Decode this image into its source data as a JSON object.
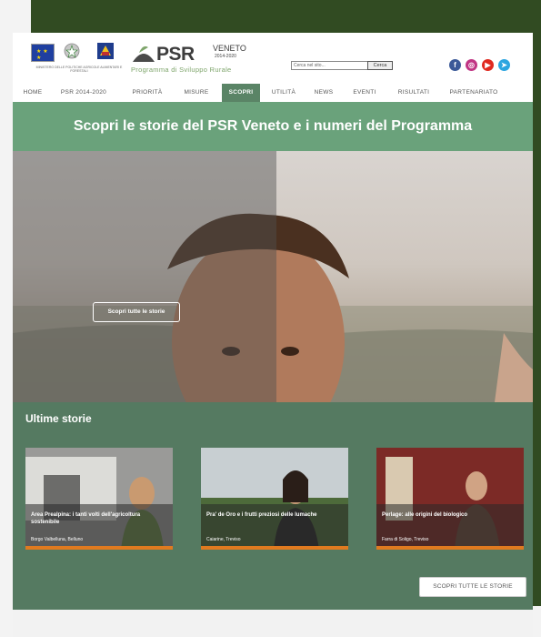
{
  "header": {
    "ministry_text": "MINISTERO DELLE POLITICHE AGRICOLE ALIMENTARI E FORESTALI",
    "logo_main": "PSR",
    "logo_region": "VENETO",
    "logo_years": "2014-2020",
    "logo_subtitle": "Programma di Sviluppo Rurale",
    "search_placeholder": "Cerca nel sito...",
    "search_button": "Cerca",
    "social_icons": [
      "facebook-icon",
      "instagram-icon",
      "youtube-icon",
      "telegram-icon"
    ]
  },
  "nav": {
    "items": [
      "HOME",
      "PSR 2014-2020",
      "PRIORITÀ",
      "MISURE",
      "SCOPRI",
      "UTILITÀ",
      "NEWS",
      "EVENTI",
      "RISULTATI",
      "PARTENARIATO"
    ],
    "active": "SCOPRI"
  },
  "hero": {
    "title": "Scopri le storie del PSR Veneto e i numeri del Programma",
    "button": "Scopri tutte le storie"
  },
  "stories": {
    "heading": "Ultime storie",
    "cards": [
      {
        "title": "Area Prealpina: i tanti volti dell'agricoltura sostenibile",
        "place": "Borgo Valbelluna, Belluno"
      },
      {
        "title": "Pra' de Oro e i frutti preziosi delle lumache",
        "place": "Caiarine, Treviso"
      },
      {
        "title": "Perlage: alle origini del biologico",
        "place": "Farra di Soligo, Treviso"
      }
    ],
    "all_button": "SCOPRI TUTTE LE STORIE"
  },
  "colors": {
    "dark_frame": "#314b22",
    "title_band": "#6aa27b",
    "stories_bg": "#557a61",
    "accent_orange": "#e07a1f",
    "nav_active": "#5a8466"
  }
}
